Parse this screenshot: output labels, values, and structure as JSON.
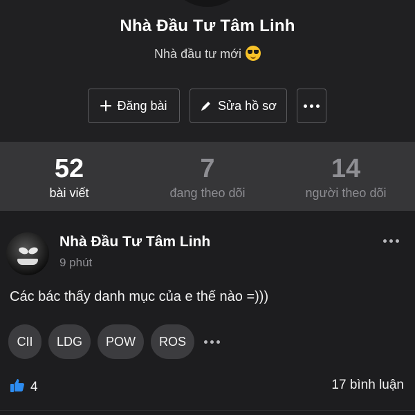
{
  "profile": {
    "name": "Nhà Đầu Tư Tâm Linh",
    "bio": "Nhà đầu tư mới",
    "bio_emoji": "smiling-face-with-sunglasses-icon",
    "actions": {
      "post_label": "Đăng bài",
      "edit_label": "Sửa hồ sơ"
    }
  },
  "stats": [
    {
      "value": "52",
      "label": "bài viết"
    },
    {
      "value": "7",
      "label": "đang theo dõi"
    },
    {
      "value": "14",
      "label": "người theo dõi"
    }
  ],
  "post": {
    "author": "Nhà Đầu Tư Tâm Linh",
    "time": "9 phút",
    "content": "Các bác thấy danh mục của e thế nào =)))",
    "tags": [
      "CII",
      "LDG",
      "POW",
      "ROS"
    ],
    "likes": "4",
    "comments": "17 bình luận"
  },
  "colors": {
    "background": "#1d1d1f",
    "stats_background": "#363638",
    "tag_background": "#3c3c3f",
    "like_blue": "#2d8cf0",
    "muted_text": "#8e8e93"
  }
}
